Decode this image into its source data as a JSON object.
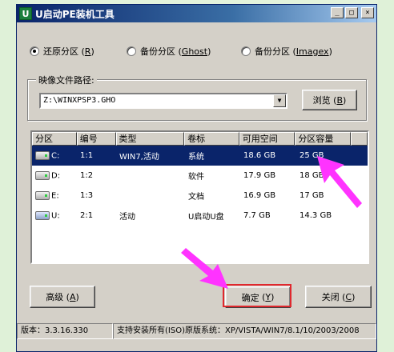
{
  "window": {
    "title": "U启动PE装机工具",
    "app_icon": "U",
    "minimize": "_",
    "maximize": "□",
    "close": "×"
  },
  "modes": [
    {
      "label": "还原分区",
      "accel": "R",
      "selected": true
    },
    {
      "label": "备份分区",
      "accel": "Ghost",
      "selected": false
    },
    {
      "label": "备份分区",
      "accel": "Imagex",
      "selected": false
    }
  ],
  "image_path": {
    "label": "映像文件路径:",
    "value": "Z:\\WINXPSP3.GHO",
    "browse_label": "浏览",
    "browse_accel": "B"
  },
  "table": {
    "columns": [
      "分区",
      "编号",
      "类型",
      "卷标",
      "可用空间",
      "分区容量"
    ],
    "rows": [
      {
        "drive": "C:",
        "num": "1:1",
        "type": "WIN7,活动",
        "label": "系统",
        "free": "18.6 GB",
        "size": "25 GB",
        "selected": true,
        "icon": "hard-disk-icon"
      },
      {
        "drive": "D:",
        "num": "1:2",
        "type": "",
        "label": "软件",
        "free": "17.9 GB",
        "size": "18 GB",
        "selected": false,
        "icon": "hard-disk-icon"
      },
      {
        "drive": "E:",
        "num": "1:3",
        "type": "",
        "label": "文档",
        "free": "16.9 GB",
        "size": "17 GB",
        "selected": false,
        "icon": "hard-disk-icon"
      },
      {
        "drive": "U:",
        "num": "2:1",
        "type": "活动",
        "label": "U启动U盘",
        "free": "7.7 GB",
        "size": "14.3 GB",
        "selected": false,
        "icon": "usb-disk-icon"
      }
    ]
  },
  "buttons": {
    "advanced": "高级",
    "advanced_accel": "A",
    "ok": "确定",
    "ok_accel": "Y",
    "close": "关闭",
    "close_accel": "C"
  },
  "status": {
    "version": "版本：3.3.16.330",
    "support": "支持安装所有(ISO)原版系统：XP/VISTA/WIN7/8.1/10/2003/2008"
  },
  "colors": {
    "annotation_arrow": "#ff33ff",
    "highlight_box": "#e0282e",
    "selection": "#0a246a"
  }
}
